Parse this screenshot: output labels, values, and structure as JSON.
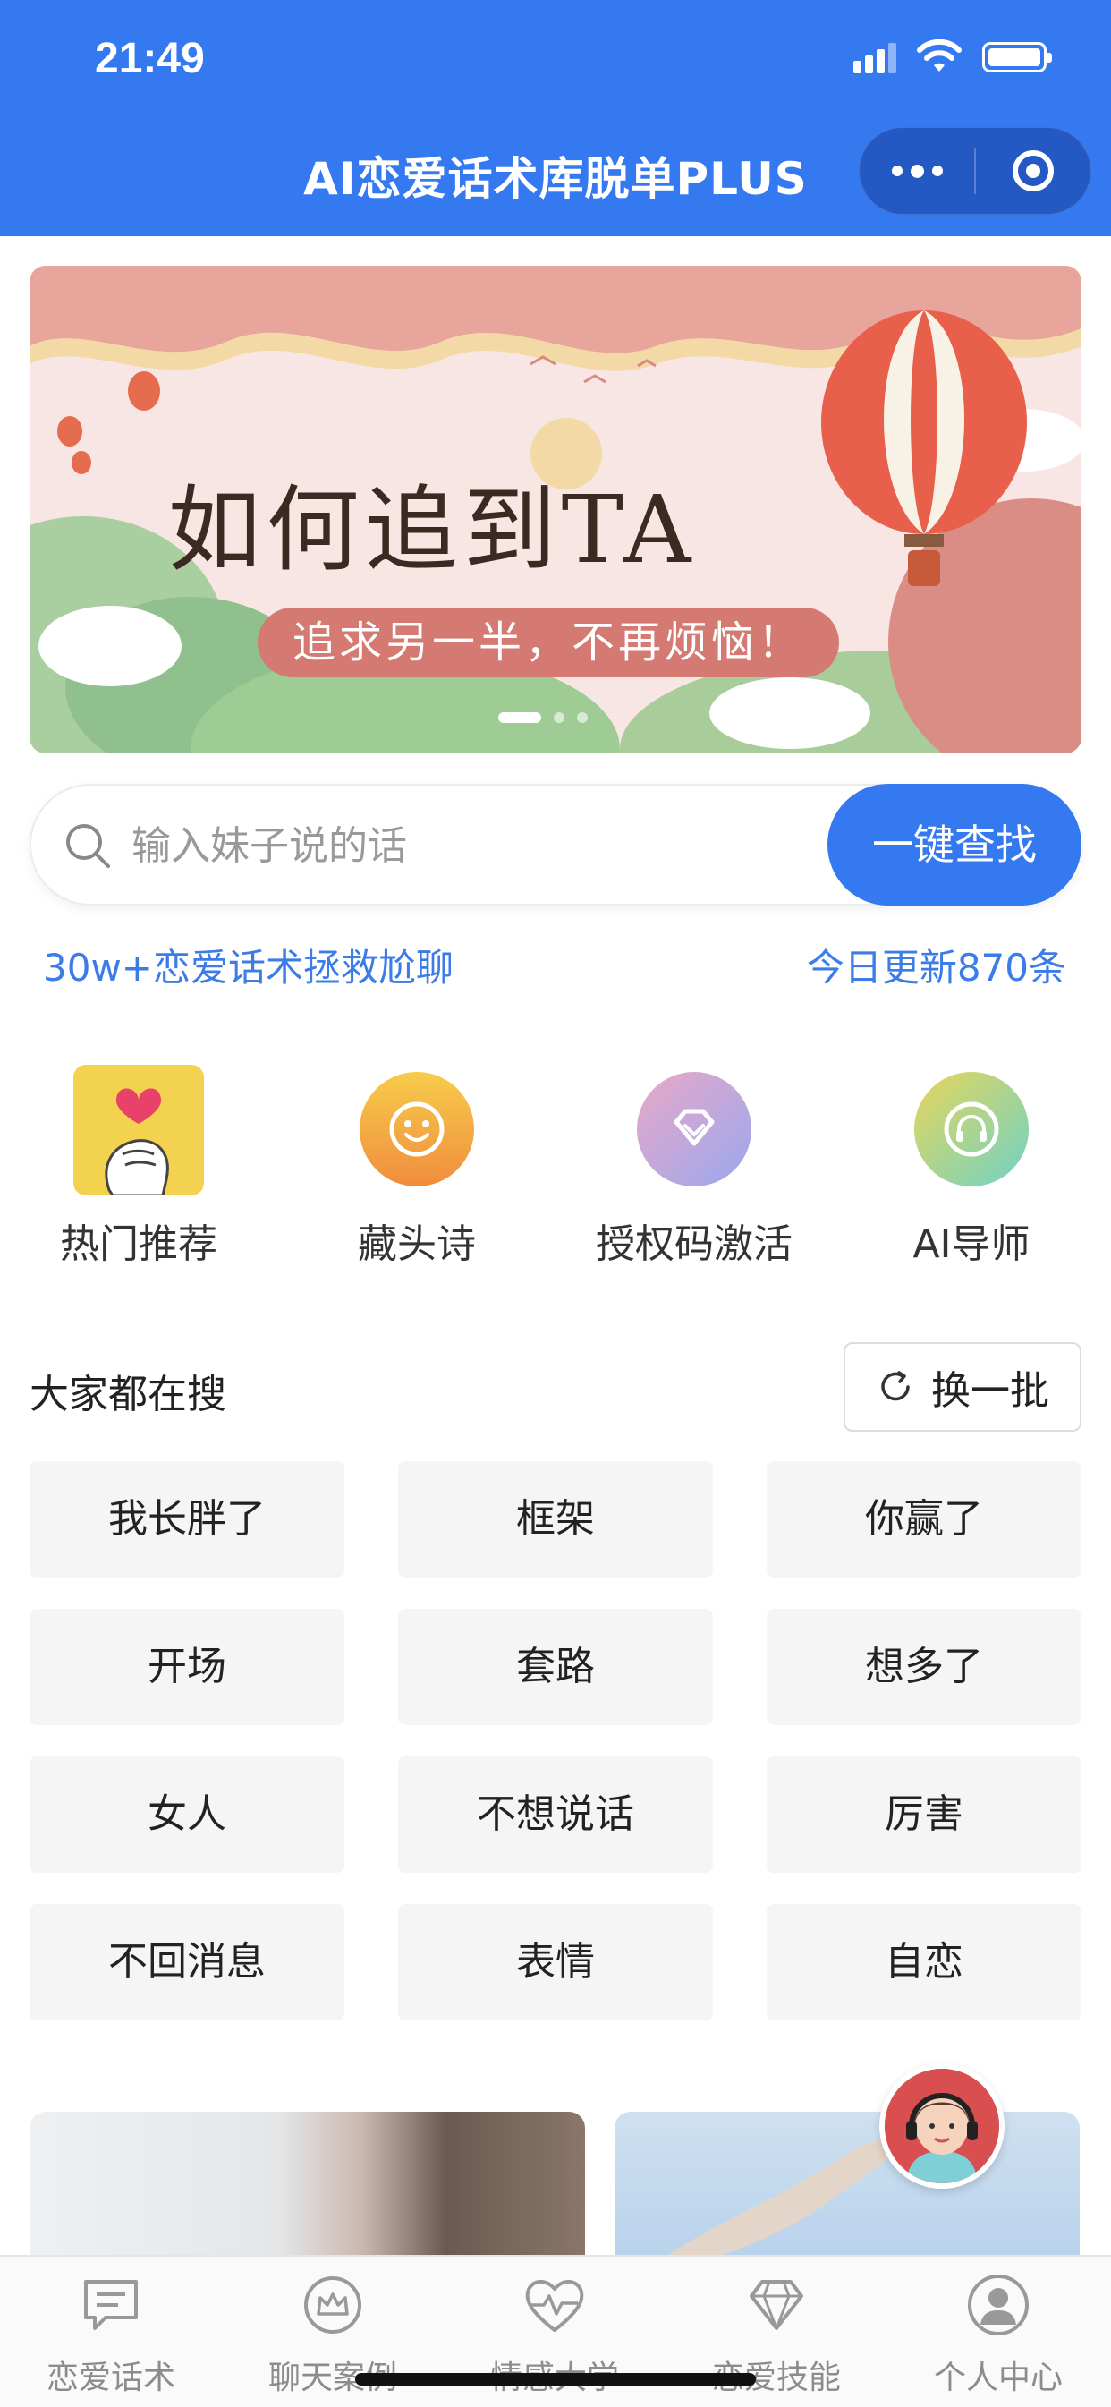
{
  "status_bar": {
    "time": "21:49"
  },
  "nav": {
    "title": "AI恋爱话术库脱单PLUS"
  },
  "banner": {
    "title": "如何追到TA",
    "subtitle": "追求另一半，不再烦恼！",
    "pages": 3,
    "active_page": 1
  },
  "search": {
    "placeholder": "输入妹子说的话",
    "button_label": "一键查找"
  },
  "stats": {
    "left": "30w+恋爱话术拯救尬聊",
    "right": "今日更新870条"
  },
  "quick_entries": [
    {
      "label": "热门推荐",
      "icon": "heart-hand-icon"
    },
    {
      "label": "藏头诗",
      "icon": "smiley-icon"
    },
    {
      "label": "授权码激活",
      "icon": "diamond-icon"
    },
    {
      "label": "AI导师",
      "icon": "headphones-icon"
    }
  ],
  "popular": {
    "title": "大家都在搜",
    "refresh_label": "换一批",
    "tags": [
      "我长胖了",
      "框架",
      "你赢了",
      "开场",
      "套路",
      "想多了",
      "女人",
      "不想说话",
      "厉害",
      "不回消息",
      "表情",
      "自恋"
    ]
  },
  "tabbar": {
    "items": [
      {
        "label": "恋爱话术",
        "icon": "chat-icon"
      },
      {
        "label": "聊天案例",
        "icon": "crown-icon"
      },
      {
        "label": "情感大学",
        "icon": "heartbeat-icon"
      },
      {
        "label": "恋爱技能",
        "icon": "diamond-icon"
      },
      {
        "label": "个人中心",
        "icon": "user-icon"
      }
    ]
  },
  "colors": {
    "primary": "#3579f0",
    "accent_text": "#3b7ce6",
    "tag_bg": "#f5f5f5"
  }
}
